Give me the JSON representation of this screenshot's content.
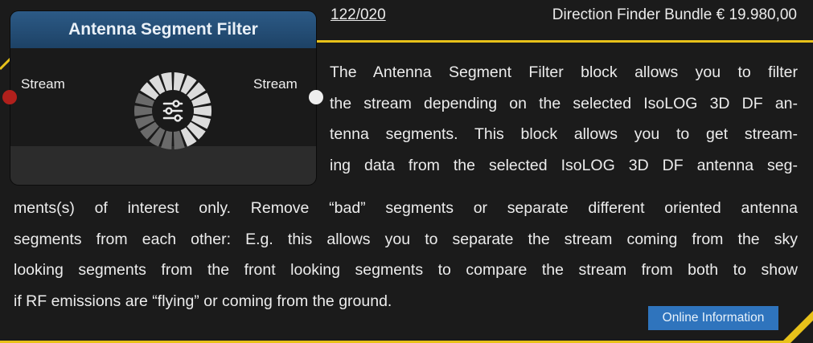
{
  "node": {
    "title": "Antenna Segment Filter",
    "input_label": "Stream",
    "output_label": "Stream",
    "icon": "sliders-wheel-icon"
  },
  "header": {
    "article_no": "122/020",
    "product": "Direction Finder Bundle € 19.980,00"
  },
  "description": {
    "lines_right": [
      "The Antenna Segment Filter block allows you to filter",
      "the stream depending on the selected IsoLOG 3D DF an-",
      "tenna segments. This block allows you to get stream-",
      "ing data from the selected IsoLOG 3D DF antenna seg-"
    ],
    "lines_full": [
      "ments(s) of interest only. Remove “bad” segments or separate different oriented antenna",
      "segments from each other: E.g. this allows you to separate the stream coming from the sky",
      "looking segments from the front looking segments to compare the stream from both to show",
      "if RF emissions are “flying” or coming from the ground."
    ]
  },
  "online_button": "Online Information",
  "colors": {
    "accent_yellow": "#e8c21a",
    "header_blue": "#2c5a86",
    "button_blue": "#2f74bd",
    "input_port": "#b1201c",
    "output_port": "#eeeeee"
  }
}
